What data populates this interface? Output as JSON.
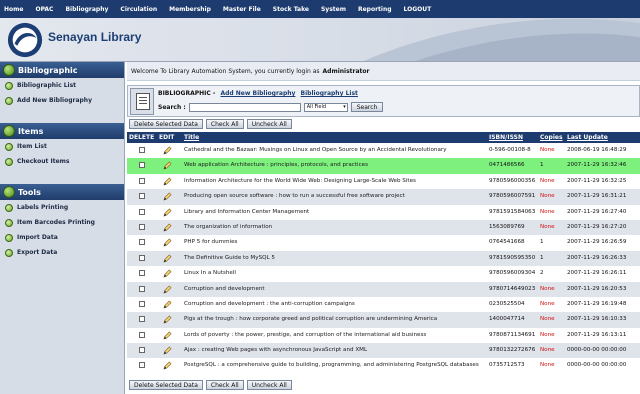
{
  "topnav": [
    "Home",
    "OPAC",
    "Bibliography",
    "Circulation",
    "Membership",
    "Master File",
    "Stock Take",
    "System",
    "Reporting",
    "LOGOUT"
  ],
  "header": {
    "brand": "Senayan Library"
  },
  "sidebar": {
    "sections": [
      {
        "title": "Bibliographic",
        "items": [
          "Bibliographic List",
          "Add New Bibliography"
        ]
      },
      {
        "title": "Items",
        "items": [
          "Item List",
          "Checkout Items"
        ]
      },
      {
        "title": "Tools",
        "items": [
          "Labels Printing",
          "Item Barcodes Printing",
          "Import Data",
          "Export Data"
        ]
      }
    ]
  },
  "welcome": {
    "text": "Welcome To Library Automation System, you currently login as",
    "user": "Administrator"
  },
  "search": {
    "heading": "BIBLIOGRAPHIC -",
    "add_link": "Add New Bibliography",
    "list_link": "Bibliography List",
    "label": "Search :",
    "value": "",
    "field": "All Field",
    "button": "Search"
  },
  "actions": {
    "delete": "Delete Selected Data",
    "check_all": "Check All",
    "uncheck_all": "Uncheck All"
  },
  "table": {
    "columns": {
      "delete": "DELETE",
      "edit": "EDIT",
      "title": "Title",
      "isbn": "ISBN/ISSN",
      "copies": "Copies",
      "last_update": "Last Update"
    },
    "rows": [
      {
        "title": "Cathedral and the Bazaar: Musings on Linux and Open Source by an Accidental Revolutionary",
        "isbn": "0-596-00108-8",
        "copies": "None",
        "last_update": "2008-06-19 16:48:29"
      },
      {
        "title": "Web application Architecture : principles, protocols, and practices",
        "isbn": "0471486566",
        "copies": "1",
        "last_update": "2007-11-29 16:32:46"
      },
      {
        "title": "Information Architecture for the World Wide Web: Designing Large-Scale Web Sites",
        "isbn": "9780596000356",
        "copies": "None",
        "last_update": "2007-11-29 16:32:25"
      },
      {
        "title": "Producing open source software : how to run a successful free software project",
        "isbn": "9780596007591",
        "copies": "None",
        "last_update": "2007-11-29 16:31:21"
      },
      {
        "title": "Library and Information Center Management",
        "isbn": "9781591584063",
        "copies": "None",
        "last_update": "2007-11-29 16:27:40"
      },
      {
        "title": "The organization of information",
        "isbn": "1563089769",
        "copies": "None",
        "last_update": "2007-11-29 16:27:20"
      },
      {
        "title": "PHP 5 for dummies",
        "isbn": "0764541668",
        "copies": "1",
        "last_update": "2007-11-29 16:26:59"
      },
      {
        "title": "The Definitive Guide to MySQL 5",
        "isbn": "9781590595350",
        "copies": "1",
        "last_update": "2007-11-29 16:26:33"
      },
      {
        "title": "Linux In a Nutshell",
        "isbn": "9780596009304",
        "copies": "2",
        "last_update": "2007-11-29 16:26:11"
      },
      {
        "title": "Corruption and development",
        "isbn": "9780714649023",
        "copies": "None",
        "last_update": "2007-11-29 16:20:53"
      },
      {
        "title": "Corruption and development : the anti-corruption campaigns",
        "isbn": "0230525504",
        "copies": "None",
        "last_update": "2007-11-29 16:19:48"
      },
      {
        "title": "Pigs at the trough : how corporate greed and political corruption are undermining America",
        "isbn": "1400047714",
        "copies": "None",
        "last_update": "2007-11-29 16:10:33"
      },
      {
        "title": "Lords of poverty : the power, prestige, and corruption of the international aid business",
        "isbn": "9780871134691",
        "copies": "None",
        "last_update": "2007-11-29 16:13:11"
      },
      {
        "title": "Ajax : creating Web pages with asynchronous JavaScript and XML",
        "isbn": "9780132272676",
        "copies": "None",
        "last_update": "0000-00-00 00:00:00"
      },
      {
        "title": "PostgreSQL : a comprehensive guide to building, programming, and administering PostgreSQL databases",
        "isbn": "0735712573",
        "copies": "None",
        "last_update": "0000-00-00 00:00:00"
      }
    ]
  },
  "colors": {
    "nav": "#1d3b6e",
    "highlight": "#7df07d",
    "none_text": "#d01010"
  }
}
